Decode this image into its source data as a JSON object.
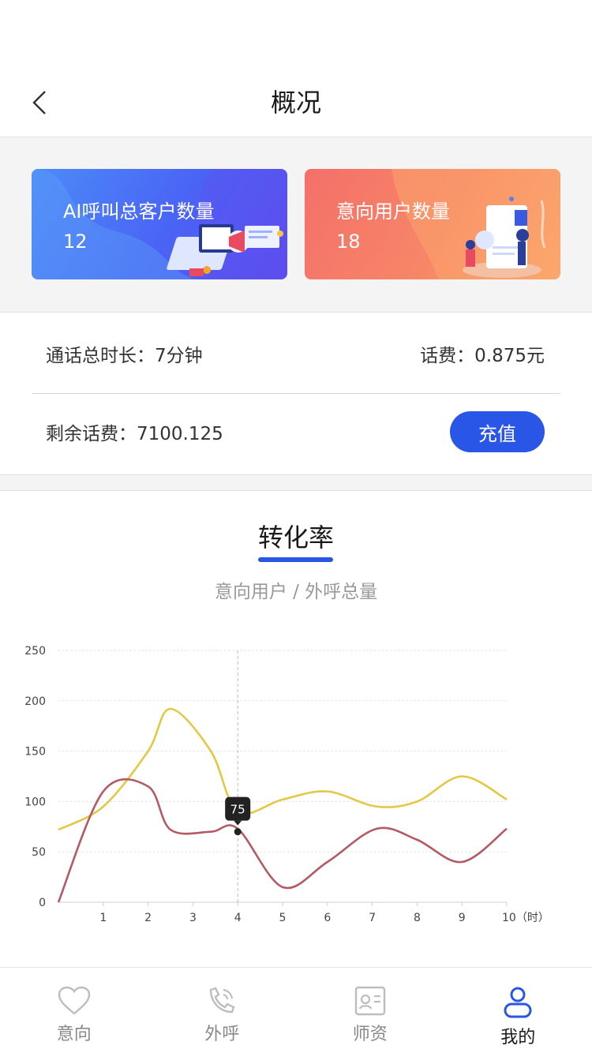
{
  "header": {
    "title": "概况"
  },
  "cards": [
    {
      "label": "AI呼叫总客户数量",
      "value": "12"
    },
    {
      "label": "意向用户数量",
      "value": "18"
    }
  ],
  "stats": {
    "call_duration": "通话总时长：7分钟",
    "call_fee": "话费：0.875元",
    "balance": "剩余话费：7100.125",
    "recharge_label": "充值"
  },
  "conversion": {
    "title": "转化率",
    "subtitle": "意向用户 / 外呼总量"
  },
  "chart_data": {
    "type": "line",
    "x": [
      0,
      1,
      2,
      3,
      4,
      5,
      6,
      7,
      8,
      9,
      10
    ],
    "x_tick_labels": [
      "1",
      "2",
      "3",
      "4",
      "5",
      "6",
      "7",
      "8",
      "9",
      "10（时）"
    ],
    "y_tick_labels": [
      "0",
      "50",
      "100",
      "150",
      "200",
      "250"
    ],
    "ylim": [
      0,
      250
    ],
    "xlim": [
      0,
      10
    ],
    "series": [
      {
        "color": "#e3c844",
        "values": [
          72,
          95,
          150,
          192,
          150,
          90,
          102,
          110,
          95,
          100,
          125,
          102
        ]
      },
      {
        "color": "#b45a64",
        "values": [
          0,
          110,
          115,
          72,
          70,
          73,
          15,
          40,
          73,
          62,
          40,
          73
        ]
      }
    ],
    "x_points": [
      0,
      1,
      2,
      2.5,
      3.4,
      4,
      5,
      6,
      7.1,
      8,
      9,
      10
    ],
    "tooltip": {
      "x": 4,
      "value": "75"
    },
    "grid": true
  },
  "tabs": [
    {
      "label": "意向",
      "icon": "heart-icon",
      "active": false
    },
    {
      "label": "外呼",
      "icon": "phone-icon",
      "active": false
    },
    {
      "label": "师资",
      "icon": "contact-card-icon",
      "active": false
    },
    {
      "label": "我的",
      "icon": "user-icon",
      "active": true
    }
  ]
}
